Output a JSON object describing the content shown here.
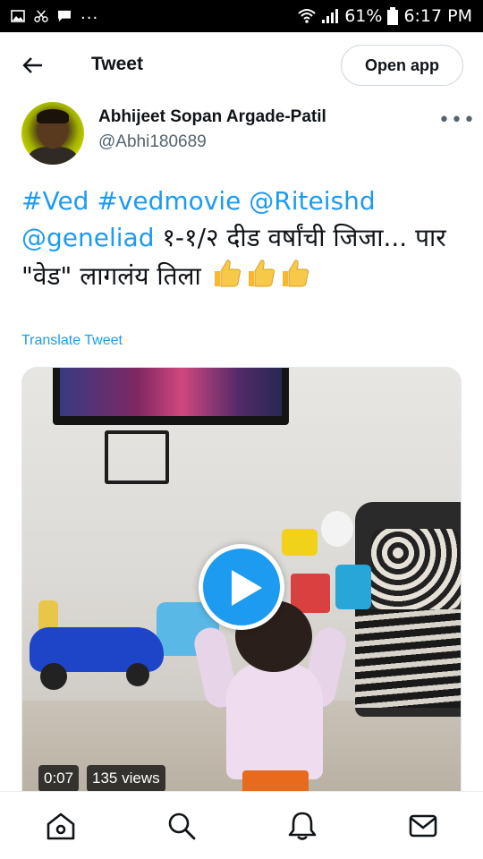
{
  "status_bar": {
    "battery": "61%",
    "time": "6:17 PM",
    "more": "...",
    "icons": [
      "image-icon",
      "scissors-icon",
      "chat-icon",
      "wifi-icon",
      "signal-icon",
      "battery-icon"
    ]
  },
  "header": {
    "title": "Tweet",
    "open_app_label": "Open app",
    "back_icon": "back-arrow-icon"
  },
  "author": {
    "name": "Abhijeet Sopan Argade-Patil",
    "handle": "@Abhi180689",
    "more_icon": "more-options-icon"
  },
  "tweet": {
    "link1": "#Ved",
    "link2": "#vedmovie",
    "link3": "@Riteishd",
    "link4": "@geneliad",
    "text": "१-१/२ दीड वर्षांची जिजा... पार \"वेड\" लागलंय तिला",
    "emoji_icon": "thumbs-up-icon",
    "emoji_count": 3,
    "translate_label": "Translate Tweet"
  },
  "media": {
    "type": "video",
    "duration": "0:07",
    "views": "135 views",
    "play_icon": "play-icon"
  },
  "bottom_nav": {
    "items": [
      "home-icon",
      "search-icon",
      "notifications-icon",
      "messages-icon"
    ]
  },
  "colors": {
    "accent": "#1d9bf0",
    "text": "#0f1419",
    "secondary_text": "#536471"
  }
}
